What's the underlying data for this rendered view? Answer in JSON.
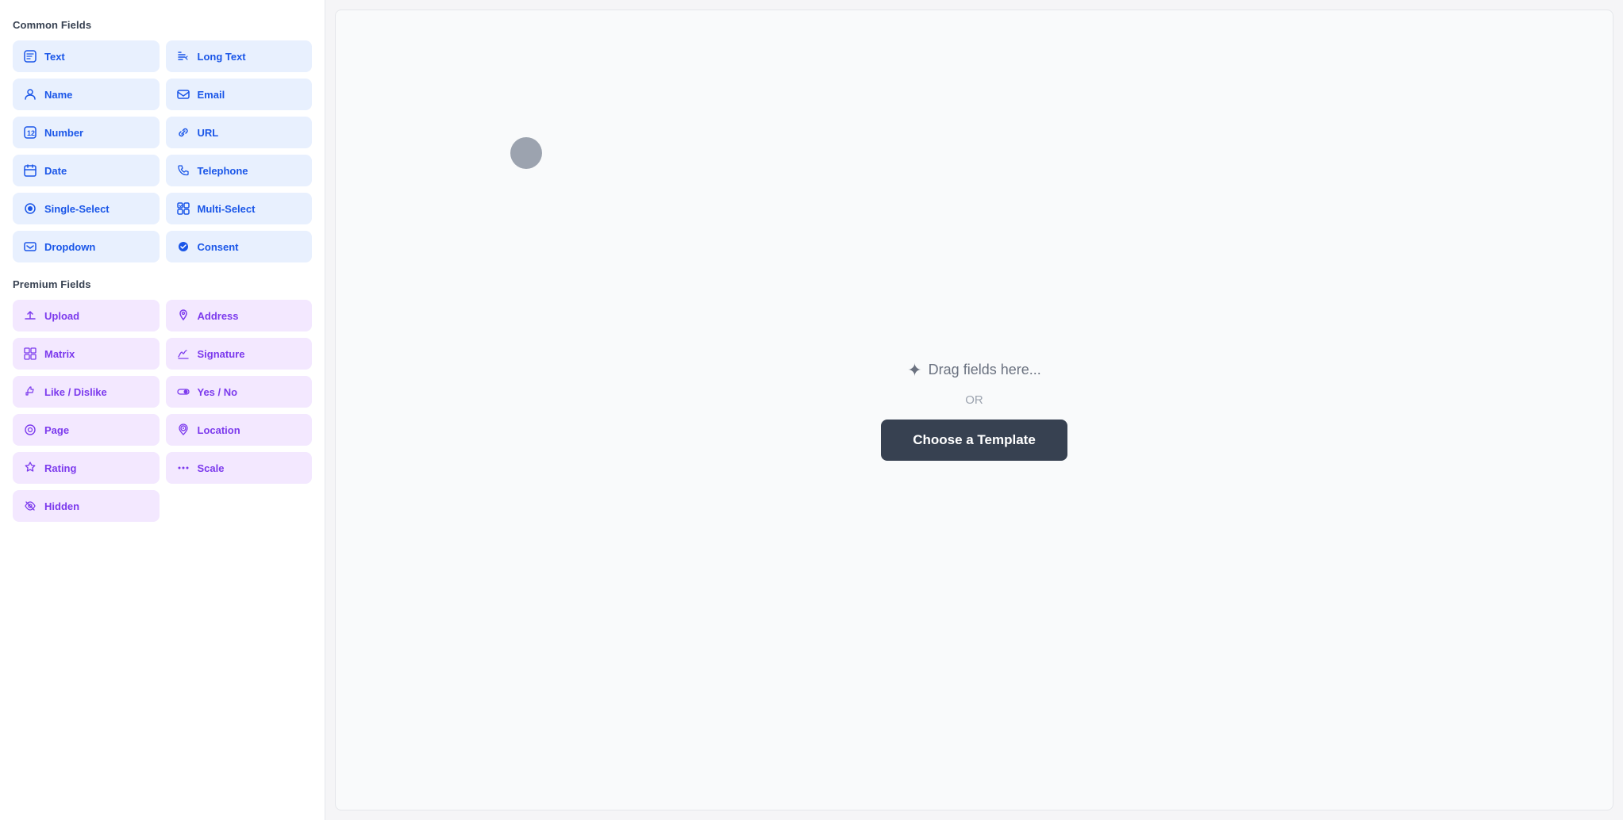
{
  "sidebar": {
    "common_section_label": "Common Fields",
    "premium_section_label": "Premium Fields",
    "common_fields": [
      {
        "id": "text",
        "label": "Text",
        "icon": "⊡"
      },
      {
        "id": "long-text",
        "label": "Long Text",
        "icon": "✏"
      },
      {
        "id": "name",
        "label": "Name",
        "icon": "☺"
      },
      {
        "id": "email",
        "label": "Email",
        "icon": "◎"
      },
      {
        "id": "number",
        "label": "Number",
        "icon": "⊞"
      },
      {
        "id": "url",
        "label": "URL",
        "icon": "🔗"
      },
      {
        "id": "date",
        "label": "Date",
        "icon": "📅"
      },
      {
        "id": "telephone",
        "label": "Telephone",
        "icon": "📞"
      },
      {
        "id": "single-select",
        "label": "Single-Select",
        "icon": "◉"
      },
      {
        "id": "multi-select",
        "label": "Multi-Select",
        "icon": "☑"
      },
      {
        "id": "dropdown",
        "label": "Dropdown",
        "icon": "☰"
      },
      {
        "id": "consent",
        "label": "Consent",
        "icon": "✔"
      }
    ],
    "premium_fields": [
      {
        "id": "upload",
        "label": "Upload",
        "icon": "⬆"
      },
      {
        "id": "address",
        "label": "Address",
        "icon": "📍"
      },
      {
        "id": "matrix",
        "label": "Matrix",
        "icon": "⊞"
      },
      {
        "id": "signature",
        "label": "Signature",
        "icon": "✍"
      },
      {
        "id": "like-dislike",
        "label": "Like / Dislike",
        "icon": "👍"
      },
      {
        "id": "yes-no",
        "label": "Yes / No",
        "icon": "⏺"
      },
      {
        "id": "page",
        "label": "Page",
        "icon": "⊙"
      },
      {
        "id": "location",
        "label": "Location",
        "icon": "◎"
      },
      {
        "id": "rating",
        "label": "Rating",
        "icon": "★"
      },
      {
        "id": "scale",
        "label": "Scale",
        "icon": "⋯"
      },
      {
        "id": "hidden",
        "label": "Hidden",
        "icon": "👁"
      }
    ]
  },
  "canvas": {
    "drag_text": "Drag fields here...",
    "or_label": "OR",
    "choose_template_label": "Choose a Template"
  }
}
